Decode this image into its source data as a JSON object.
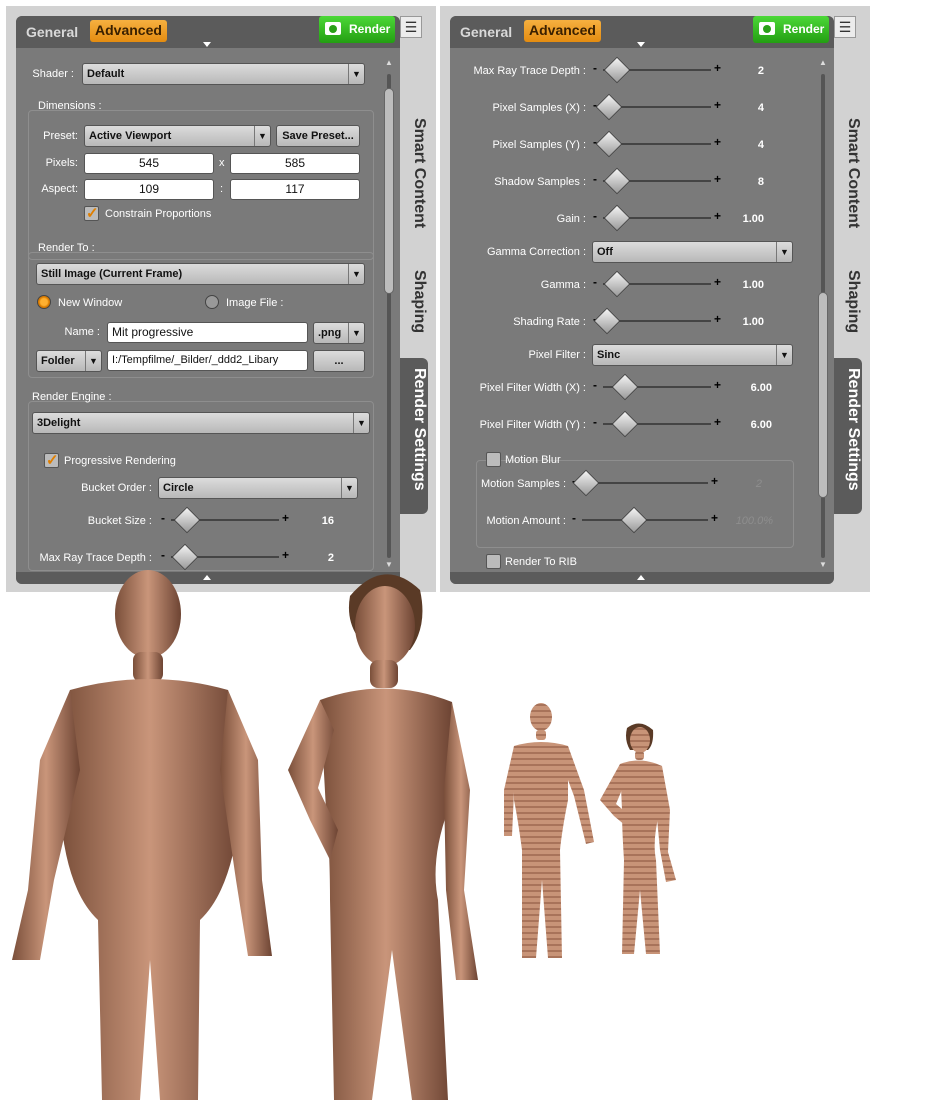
{
  "panel": {
    "tabs": [
      "General",
      "Advanced"
    ],
    "render_label": "Render",
    "side_tabs": [
      "Smart Content",
      "Shaping",
      "Render Settings"
    ]
  },
  "left": {
    "shader_label": "Shader :",
    "shader_value": "Default",
    "dimensions_label": "Dimensions :",
    "preset_label": "Preset:",
    "preset_value": "Active Viewport",
    "save_preset": "Save Preset...",
    "pixels_label": "Pixels:",
    "pixels_w": "545",
    "pixels_sep": "x",
    "pixels_h": "585",
    "aspect_label": "Aspect:",
    "aspect_w": "109",
    "aspect_sep": ":",
    "aspect_h": "117",
    "constrain_label": "Constrain Proportions",
    "render_to_label": "Render To :",
    "render_to_value": "Still Image (Current Frame)",
    "new_window": "New Window",
    "image_file": "Image File :",
    "name_label": "Name :",
    "name_value": "Mit progressive",
    "ext_value": ".png",
    "folder_label": "Folder",
    "folder_path": "I:/Tempfilme/_Bilder/_ddd2_Libary",
    "browse": "...",
    "engine_label": "Render Engine :",
    "engine_value": "3Delight",
    "progressive_label": "Progressive Rendering",
    "bucket_order_label": "Bucket Order :",
    "bucket_order_value": "Circle",
    "bucket_size_label": "Bucket Size :",
    "bucket_size_value": "16",
    "max_ray_label": "Max Ray Trace Depth :",
    "max_ray_value": "2"
  },
  "right": {
    "max_ray_label": "Max Ray Trace Depth :",
    "max_ray_value": "2",
    "px_x_label": "Pixel Samples (X) :",
    "px_x_value": "4",
    "px_y_label": "Pixel Samples (Y) :",
    "px_y_value": "4",
    "shadow_label": "Shadow Samples :",
    "shadow_value": "8",
    "gain_label": "Gain :",
    "gain_value": "1.00",
    "gamma_corr_label": "Gamma Correction :",
    "gamma_corr_value": "Off",
    "gamma_label": "Gamma :",
    "gamma_value": "1.00",
    "shading_label": "Shading Rate :",
    "shading_value": "1.00",
    "filter_label": "Pixel Filter :",
    "filter_value": "Sinc",
    "fw_x_label": "Pixel Filter Width (X) :",
    "fw_x_value": "6.00",
    "fw_y_label": "Pixel Filter Width (Y) :",
    "fw_y_value": "6.00",
    "motion_blur_label": "Motion Blur",
    "motion_samples_label": "Motion Samples :",
    "motion_samples_value": "2",
    "motion_amount_label": "Motion Amount :",
    "motion_amount_value": "100.0%",
    "rib_label": "Render To RIB"
  },
  "scene": {
    "figures": [
      "figure-male-large",
      "figure-female-large",
      "figure-male-small",
      "figure-female-small"
    ]
  }
}
